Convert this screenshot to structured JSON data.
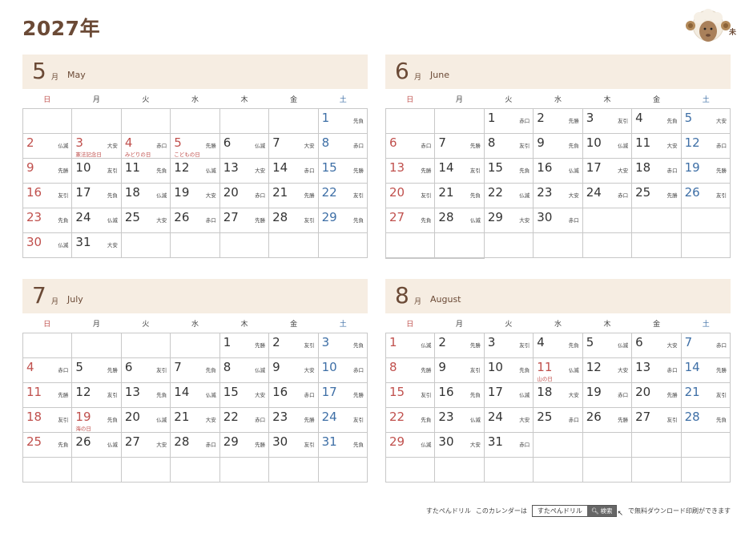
{
  "year_title": "2027年",
  "mascot": {
    "label": "未",
    "icon": "sheep-icon"
  },
  "weekdays": [
    "日",
    "月",
    "火",
    "水",
    "木",
    "金",
    "土"
  ],
  "colors": {
    "brand": "#6b4a36",
    "sunday": "#c0504d",
    "saturday": "#3e6fa6",
    "header_bg": "#f6ede2"
  },
  "months": [
    {
      "num": "5",
      "kanji": "月",
      "en": "May",
      "cells": [
        null,
        null,
        null,
        null,
        null,
        null,
        {
          "d": "1",
          "r": "先負"
        },
        {
          "d": "2",
          "r": "仏滅"
        },
        {
          "d": "3",
          "r": "大安",
          "h": "憲法記念日"
        },
        {
          "d": "4",
          "r": "赤口",
          "h": "みどりの日"
        },
        {
          "d": "5",
          "r": "先勝",
          "h": "こどもの日"
        },
        {
          "d": "6",
          "r": "仏滅"
        },
        {
          "d": "7",
          "r": "大安"
        },
        {
          "d": "8",
          "r": "赤口"
        },
        {
          "d": "9",
          "r": "先勝"
        },
        {
          "d": "10",
          "r": "友引"
        },
        {
          "d": "11",
          "r": "先負"
        },
        {
          "d": "12",
          "r": "仏滅"
        },
        {
          "d": "13",
          "r": "大安"
        },
        {
          "d": "14",
          "r": "赤口"
        },
        {
          "d": "15",
          "r": "先勝"
        },
        {
          "d": "16",
          "r": "友引"
        },
        {
          "d": "17",
          "r": "先負"
        },
        {
          "d": "18",
          "r": "仏滅"
        },
        {
          "d": "19",
          "r": "大安"
        },
        {
          "d": "20",
          "r": "赤口"
        },
        {
          "d": "21",
          "r": "先勝"
        },
        {
          "d": "22",
          "r": "友引"
        },
        {
          "d": "23",
          "r": "先負"
        },
        {
          "d": "24",
          "r": "仏滅"
        },
        {
          "d": "25",
          "r": "大安"
        },
        {
          "d": "26",
          "r": "赤口"
        },
        {
          "d": "27",
          "r": "先勝"
        },
        {
          "d": "28",
          "r": "友引"
        },
        {
          "d": "29",
          "r": "先負"
        },
        {
          "d": "30",
          "r": "仏滅"
        },
        {
          "d": "31",
          "r": "大安"
        },
        null,
        null,
        null,
        null,
        null
      ]
    },
    {
      "num": "6",
      "kanji": "月",
      "en": "June",
      "cells": [
        null,
        null,
        {
          "d": "1",
          "r": "赤口"
        },
        {
          "d": "2",
          "r": "先勝"
        },
        {
          "d": "3",
          "r": "友引"
        },
        {
          "d": "4",
          "r": "先負"
        },
        {
          "d": "5",
          "r": "大安"
        },
        {
          "d": "6",
          "r": "赤口"
        },
        {
          "d": "7",
          "r": "先勝"
        },
        {
          "d": "8",
          "r": "友引"
        },
        {
          "d": "9",
          "r": "先負"
        },
        {
          "d": "10",
          "r": "仏滅"
        },
        {
          "d": "11",
          "r": "大安"
        },
        {
          "d": "12",
          "r": "赤口"
        },
        {
          "d": "13",
          "r": "先勝"
        },
        {
          "d": "14",
          "r": "友引"
        },
        {
          "d": "15",
          "r": "先負"
        },
        {
          "d": "16",
          "r": "仏滅"
        },
        {
          "d": "17",
          "r": "大安"
        },
        {
          "d": "18",
          "r": "赤口"
        },
        {
          "d": "19",
          "r": "先勝"
        },
        {
          "d": "20",
          "r": "友引"
        },
        {
          "d": "21",
          "r": "先負"
        },
        {
          "d": "22",
          "r": "仏滅"
        },
        {
          "d": "23",
          "r": "大安"
        },
        {
          "d": "24",
          "r": "赤口"
        },
        {
          "d": "25",
          "r": "先勝"
        },
        {
          "d": "26",
          "r": "友引"
        },
        {
          "d": "27",
          "r": "先負"
        },
        {
          "d": "28",
          "r": "仏滅"
        },
        {
          "d": "29",
          "r": "大安"
        },
        {
          "d": "30",
          "r": "赤口"
        },
        null,
        null,
        null,
        null,
        null,
        null,
        null,
        null,
        null,
        null,
        null,
        null
      ]
    },
    {
      "num": "7",
      "kanji": "月",
      "en": "July",
      "cells": [
        null,
        null,
        null,
        null,
        {
          "d": "1",
          "r": "先勝"
        },
        {
          "d": "2",
          "r": "友引"
        },
        {
          "d": "3",
          "r": "先負"
        },
        {
          "d": "4",
          "r": "赤口"
        },
        {
          "d": "5",
          "r": "先勝"
        },
        {
          "d": "6",
          "r": "友引"
        },
        {
          "d": "7",
          "r": "先負"
        },
        {
          "d": "8",
          "r": "仏滅"
        },
        {
          "d": "9",
          "r": "大安"
        },
        {
          "d": "10",
          "r": "赤口"
        },
        {
          "d": "11",
          "r": "先勝"
        },
        {
          "d": "12",
          "r": "友引"
        },
        {
          "d": "13",
          "r": "先負"
        },
        {
          "d": "14",
          "r": "仏滅"
        },
        {
          "d": "15",
          "r": "大安"
        },
        {
          "d": "16",
          "r": "赤口"
        },
        {
          "d": "17",
          "r": "先勝"
        },
        {
          "d": "18",
          "r": "友引"
        },
        {
          "d": "19",
          "r": "先負",
          "h": "海の日"
        },
        {
          "d": "20",
          "r": "仏滅"
        },
        {
          "d": "21",
          "r": "大安"
        },
        {
          "d": "22",
          "r": "赤口"
        },
        {
          "d": "23",
          "r": "先勝"
        },
        {
          "d": "24",
          "r": "友引"
        },
        {
          "d": "25",
          "r": "先負"
        },
        {
          "d": "26",
          "r": "仏滅"
        },
        {
          "d": "27",
          "r": "大安"
        },
        {
          "d": "28",
          "r": "赤口"
        },
        {
          "d": "29",
          "r": "先勝"
        },
        {
          "d": "30",
          "r": "友引"
        },
        {
          "d": "31",
          "r": "先負"
        },
        null,
        null,
        null,
        null,
        null,
        null,
        null
      ]
    },
    {
      "num": "8",
      "kanji": "月",
      "en": "August",
      "cells": [
        {
          "d": "1",
          "r": "仏滅"
        },
        {
          "d": "2",
          "r": "先勝"
        },
        {
          "d": "3",
          "r": "友引"
        },
        {
          "d": "4",
          "r": "先負"
        },
        {
          "d": "5",
          "r": "仏滅"
        },
        {
          "d": "6",
          "r": "大安"
        },
        {
          "d": "7",
          "r": "赤口"
        },
        {
          "d": "8",
          "r": "先勝"
        },
        {
          "d": "9",
          "r": "友引"
        },
        {
          "d": "10",
          "r": "先負"
        },
        {
          "d": "11",
          "r": "仏滅",
          "h": "山の日"
        },
        {
          "d": "12",
          "r": "大安"
        },
        {
          "d": "13",
          "r": "赤口"
        },
        {
          "d": "14",
          "r": "先勝"
        },
        {
          "d": "15",
          "r": "友引"
        },
        {
          "d": "16",
          "r": "先負"
        },
        {
          "d": "17",
          "r": "仏滅"
        },
        {
          "d": "18",
          "r": "大安"
        },
        {
          "d": "19",
          "r": "赤口"
        },
        {
          "d": "20",
          "r": "先勝"
        },
        {
          "d": "21",
          "r": "友引"
        },
        {
          "d": "22",
          "r": "先負"
        },
        {
          "d": "23",
          "r": "仏滅"
        },
        {
          "d": "24",
          "r": "大安"
        },
        {
          "d": "25",
          "r": "赤口"
        },
        {
          "d": "26",
          "r": "先勝"
        },
        {
          "d": "27",
          "r": "友引"
        },
        {
          "d": "28",
          "r": "先負"
        },
        {
          "d": "29",
          "r": "仏滅"
        },
        {
          "d": "30",
          "r": "大安"
        },
        {
          "d": "31",
          "r": "赤口"
        },
        null,
        null,
        null,
        null,
        null,
        null,
        null,
        null,
        null,
        null,
        null
      ]
    }
  ],
  "footer": {
    "brand": "すたぺんドリル",
    "pre_text": "このカレンダーは",
    "search_text": "すたぺんドリル",
    "search_button": "検索",
    "post_text": "で無料ダウンロード印刷ができます"
  }
}
